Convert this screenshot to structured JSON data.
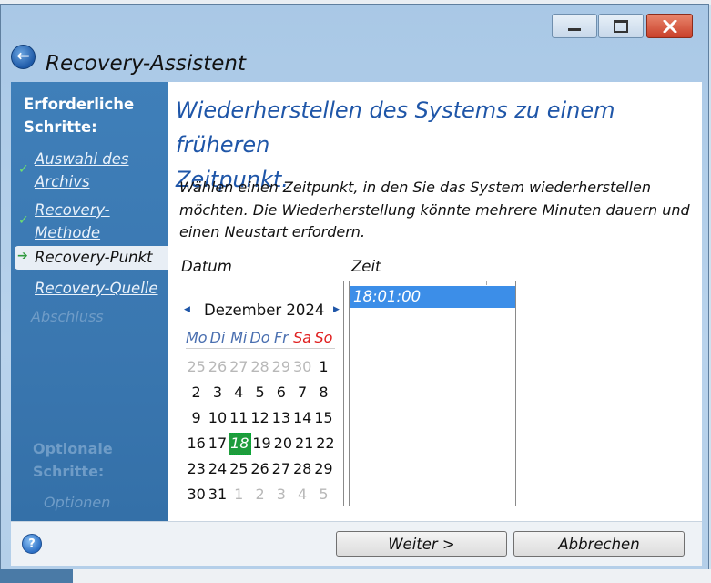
{
  "window": {
    "title": "Recovery-Assistent",
    "controls": {
      "minimize": "minimize-icon",
      "maximize": "maximize-icon",
      "close": "close-icon"
    }
  },
  "sidebar": {
    "heading_line1": "Erforderliche",
    "heading_line2": "Schritte:",
    "items": [
      {
        "line1": "Auswahl des",
        "line2": "Archivs",
        "state": "done"
      },
      {
        "line1": "Recovery-",
        "line2": "Methode",
        "state": "done"
      },
      {
        "label": "Recovery-Punkt",
        "state": "current"
      },
      {
        "label": "Recovery-Quelle",
        "state": "link"
      },
      {
        "label": "Abschluss",
        "state": "disabled"
      }
    ],
    "optional_line1": "Optionale",
    "optional_line2": "Schritte:",
    "optional_item": "Optionen"
  },
  "main": {
    "heading_line1": "Wiederherstellen des Systems zu einem früheren",
    "heading_line2": "Zeitpunkt.",
    "description_line1": "Wählen einen Zeitpunkt, in den Sie das System wiederherstellen",
    "description_line2": "möchten. Die Wiederherstellung könnte mehrere Minuten dauern und",
    "description_line3": "einen Neustart erfordern.",
    "date_label": "Datum",
    "time_label": "Zeit"
  },
  "calendar": {
    "month": "Dezember 2024",
    "weekdays": [
      "Mo",
      "Di",
      "Mi",
      "Do",
      "Fr",
      "Sa",
      "So"
    ],
    "weeks": [
      [
        "25",
        "26",
        "27",
        "28",
        "29",
        "30",
        "1"
      ],
      [
        "2",
        "3",
        "4",
        "5",
        "6",
        "7",
        "8"
      ],
      [
        "9",
        "10",
        "11",
        "12",
        "13",
        "14",
        "15"
      ],
      [
        "16",
        "17",
        "18",
        "19",
        "20",
        "21",
        "22"
      ],
      [
        "23",
        "24",
        "25",
        "26",
        "27",
        "28",
        "29"
      ],
      [
        "30",
        "31",
        "1",
        "2",
        "3",
        "4",
        "5"
      ]
    ],
    "selected_day": "18"
  },
  "times": [
    "18:01:00"
  ],
  "footer": {
    "next_label": "Weiter >",
    "cancel_label": "Abbrechen",
    "help_icon": "help-icon"
  },
  "colors": {
    "accent": "#1f56a8",
    "sidebar": "#3a77b0",
    "selection": "#3c8ee8",
    "selected_day": "#1e9c3c",
    "weekend": "#e02020"
  }
}
